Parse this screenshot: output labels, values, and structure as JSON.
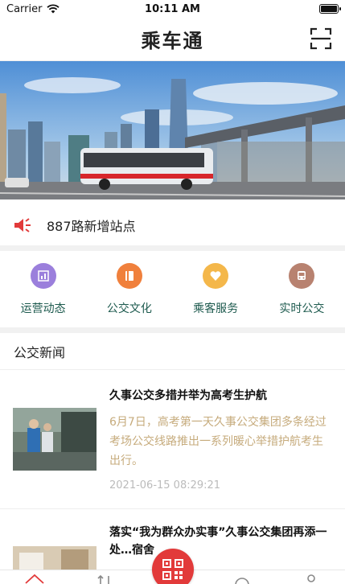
{
  "status_bar": {
    "carrier": "Carrier",
    "time": "10:11 AM"
  },
  "header": {
    "title": "乘车通"
  },
  "notice": {
    "text": "887路新增站点"
  },
  "quick_menu": [
    {
      "label": "运营动态",
      "icon": "chart-icon",
      "color": "#9b7fdc"
    },
    {
      "label": "公交文化",
      "icon": "book-icon",
      "color": "#f0803c"
    },
    {
      "label": "乘客服务",
      "icon": "heart-icon",
      "color": "#f4b74a"
    },
    {
      "label": "实时公交",
      "icon": "bus-icon",
      "color": "#b88270"
    }
  ],
  "news": {
    "section_title": "公交新闻",
    "items": [
      {
        "title": "久事公交多措并举为高考生护航",
        "summary": "6月7日，高考第一天久事公交集团多条经过考场公交线路推出一系列暖心举措护航考生出行。",
        "time": "2021-06-15 08:29:21"
      },
      {
        "title": "落实“我为群众办实事”久事公交集团再添一处…宿舍",
        "summary": "",
        "time": ""
      }
    ]
  },
  "colors": {
    "accent_red": "#e23a3a",
    "summary_gold": "#c6ab7c",
    "menu_text": "#1d5a4e"
  }
}
